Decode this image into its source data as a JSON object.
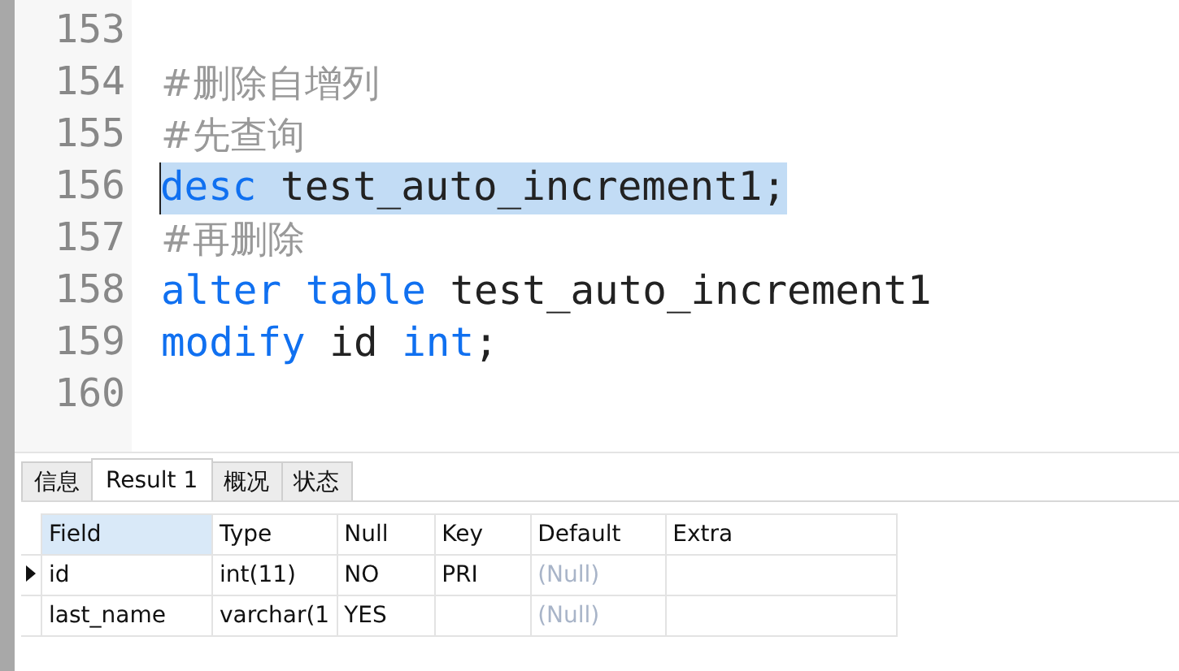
{
  "editor": {
    "lines": [
      {
        "number": "153",
        "selected": false
      },
      {
        "number": "154",
        "selected": false,
        "tokens": [
          {
            "kind": "comment",
            "text": "#删除自增列"
          }
        ]
      },
      {
        "number": "155",
        "selected": false,
        "tokens": [
          {
            "kind": "comment",
            "text": "#先查询"
          }
        ]
      },
      {
        "number": "156",
        "selected": true,
        "tokens": [
          {
            "kind": "keyword",
            "text": "desc"
          },
          {
            "kind": "plain",
            "text": "test_auto_increment1;"
          }
        ]
      },
      {
        "number": "157",
        "selected": false,
        "tokens": [
          {
            "kind": "comment",
            "text": "#再删除"
          }
        ]
      },
      {
        "number": "158",
        "selected": false,
        "tokens": [
          {
            "kind": "keyword",
            "text": "alter"
          },
          {
            "kind": "keyword",
            "text": "table"
          },
          {
            "kind": "plain",
            "text": "test_auto_increment1"
          }
        ]
      },
      {
        "number": "159",
        "selected": false,
        "tokens": [
          {
            "kind": "keyword",
            "text": "modify"
          },
          {
            "kind": "plain",
            "text": "id"
          },
          {
            "kind": "keyword",
            "text": "int"
          },
          {
            "kind": "plain",
            "text": ";",
            "attached": true
          }
        ]
      },
      {
        "number": "160",
        "selected": false
      }
    ]
  },
  "tabs": [
    {
      "label": "信息",
      "selected": false
    },
    {
      "label": "Result 1",
      "selected": true
    },
    {
      "label": "概况",
      "selected": false
    },
    {
      "label": "状态",
      "selected": false
    }
  ],
  "table": {
    "columns": [
      {
        "label": "Field",
        "selected": true
      },
      {
        "label": "Type",
        "selected": false
      },
      {
        "label": "Null",
        "selected": false
      },
      {
        "label": "Key",
        "selected": false
      },
      {
        "label": "Default",
        "selected": false
      },
      {
        "label": "Extra",
        "selected": false
      }
    ],
    "rows": [
      {
        "current": true,
        "cells": [
          {
            "kind": "value",
            "text": "id"
          },
          {
            "kind": "value",
            "text": "int(11)"
          },
          {
            "kind": "value",
            "text": "NO"
          },
          {
            "kind": "value",
            "text": "PRI"
          },
          {
            "kind": "null",
            "text": "(Null)"
          },
          {
            "kind": "empty"
          }
        ]
      },
      {
        "current": false,
        "cells": [
          {
            "kind": "value",
            "text": "last_name"
          },
          {
            "kind": "value",
            "text": "varchar(1"
          },
          {
            "kind": "value",
            "text": "YES"
          },
          {
            "kind": "empty"
          },
          {
            "kind": "null",
            "text": "(Null)"
          },
          {
            "kind": "empty"
          }
        ]
      }
    ]
  }
}
